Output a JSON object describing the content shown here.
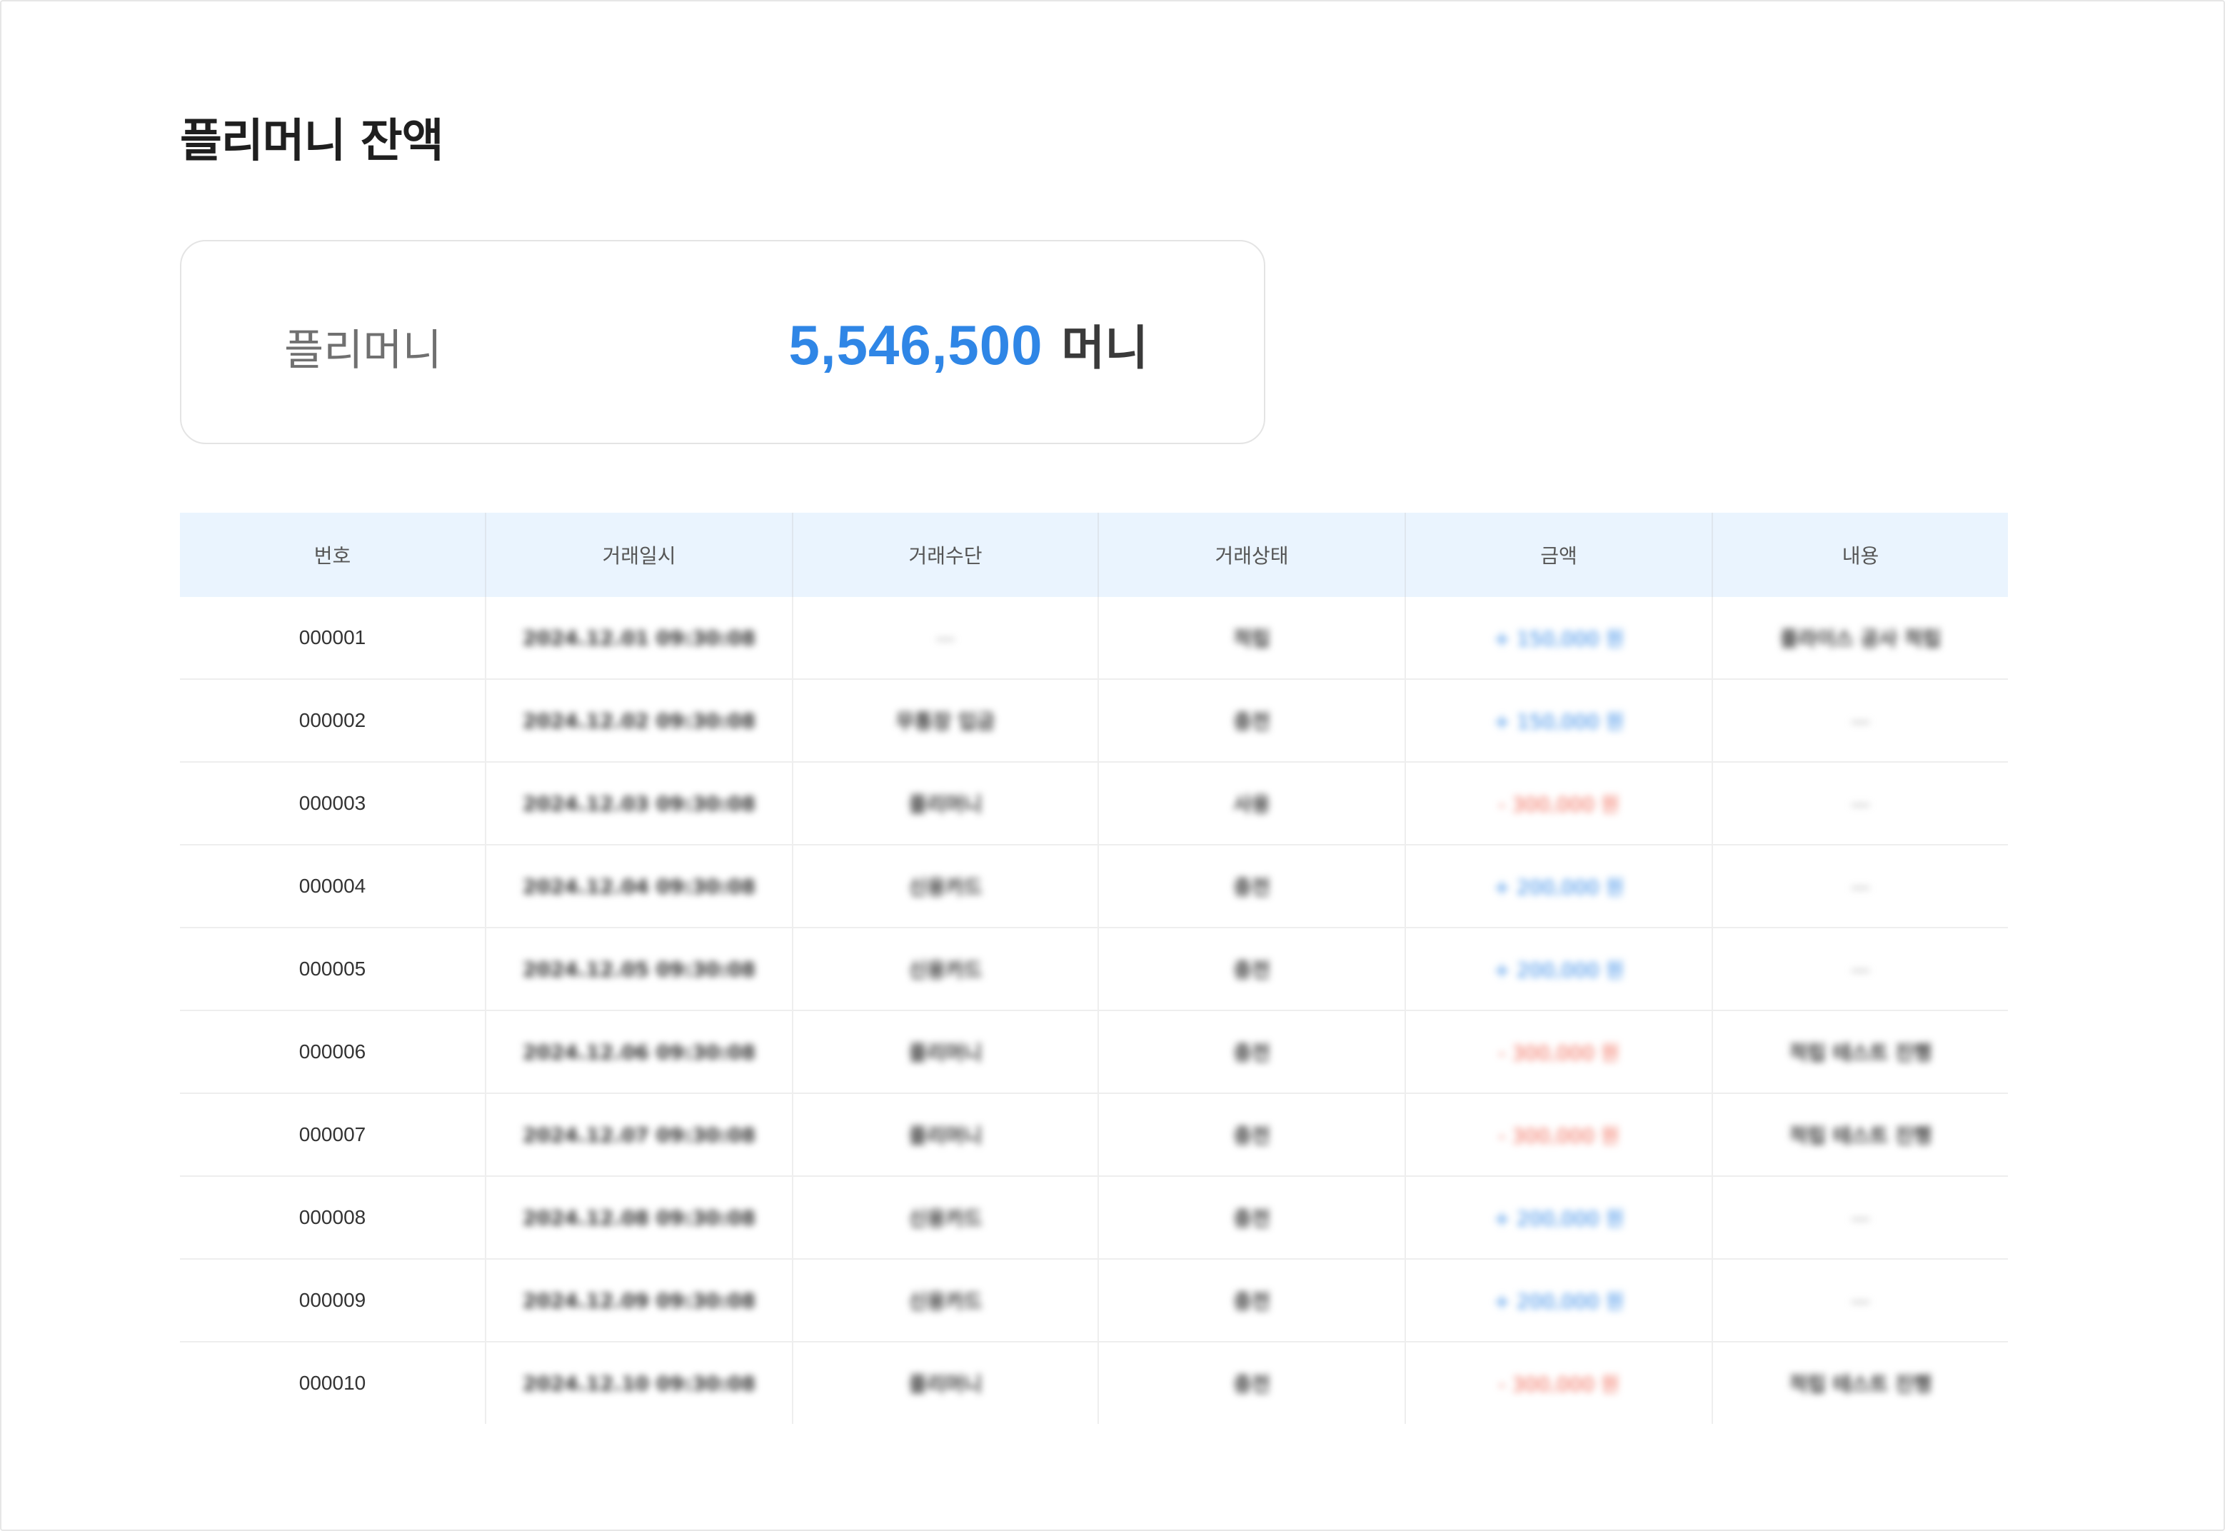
{
  "page": {
    "title": "플리머니 잔액"
  },
  "balance": {
    "label": "플리머니",
    "amount": "5,546,500",
    "unit": "머니",
    "amount_color": "#2f86e6"
  },
  "table": {
    "headers": [
      "번호",
      "거래일시",
      "거래수단",
      "거래상태",
      "금액",
      "내용"
    ],
    "rows": [
      {
        "no": "000001",
        "datetime": "2024.12.01  09:30:08",
        "method": "—",
        "status": "적립",
        "amount": "+ 150,000 원",
        "amount_type": "pos",
        "note": "플라이스 공사 적립"
      },
      {
        "no": "000002",
        "datetime": "2024.12.02  09:30:08",
        "method": "무통장 입금",
        "status": "충전",
        "amount": "+ 150,000 원",
        "amount_type": "pos",
        "note": "—"
      },
      {
        "no": "000003",
        "datetime": "2024.12.03  09:30:08",
        "method": "플리머니",
        "status": "사용",
        "amount": "- 300,000 원",
        "amount_type": "neg",
        "note": "—"
      },
      {
        "no": "000004",
        "datetime": "2024.12.04  09:30:08",
        "method": "신용카드",
        "status": "충전",
        "amount": "+ 200,000 원",
        "amount_type": "pos",
        "note": "—"
      },
      {
        "no": "000005",
        "datetime": "2024.12.05  09:30:08",
        "method": "신용카드",
        "status": "충전",
        "amount": "+ 200,000 원",
        "amount_type": "pos",
        "note": "—"
      },
      {
        "no": "000006",
        "datetime": "2024.12.06  09:30:08",
        "method": "플리머니",
        "status": "충전",
        "amount": "- 300,000 원",
        "amount_type": "neg",
        "note": "적립 테스트 진행"
      },
      {
        "no": "000007",
        "datetime": "2024.12.07  09:30:08",
        "method": "플리머니",
        "status": "충전",
        "amount": "- 300,000 원",
        "amount_type": "neg",
        "note": "적립 테스트 진행"
      },
      {
        "no": "000008",
        "datetime": "2024.12.08  09:30:08",
        "method": "신용카드",
        "status": "충전",
        "amount": "+ 200,000 원",
        "amount_type": "pos",
        "note": "—"
      },
      {
        "no": "000009",
        "datetime": "2024.12.09  09:30:08",
        "method": "신용카드",
        "status": "충전",
        "amount": "+ 200,000 원",
        "amount_type": "pos",
        "note": "—"
      },
      {
        "no": "000010",
        "datetime": "2024.12.10  09:30:08",
        "method": "플리머니",
        "status": "충전",
        "amount": "- 300,000 원",
        "amount_type": "neg",
        "note": "적립 테스트 진행"
      }
    ]
  },
  "colors": {
    "header_bg": "#eaf4fe",
    "positive": "#2f86e6",
    "negative": "#f06552"
  }
}
